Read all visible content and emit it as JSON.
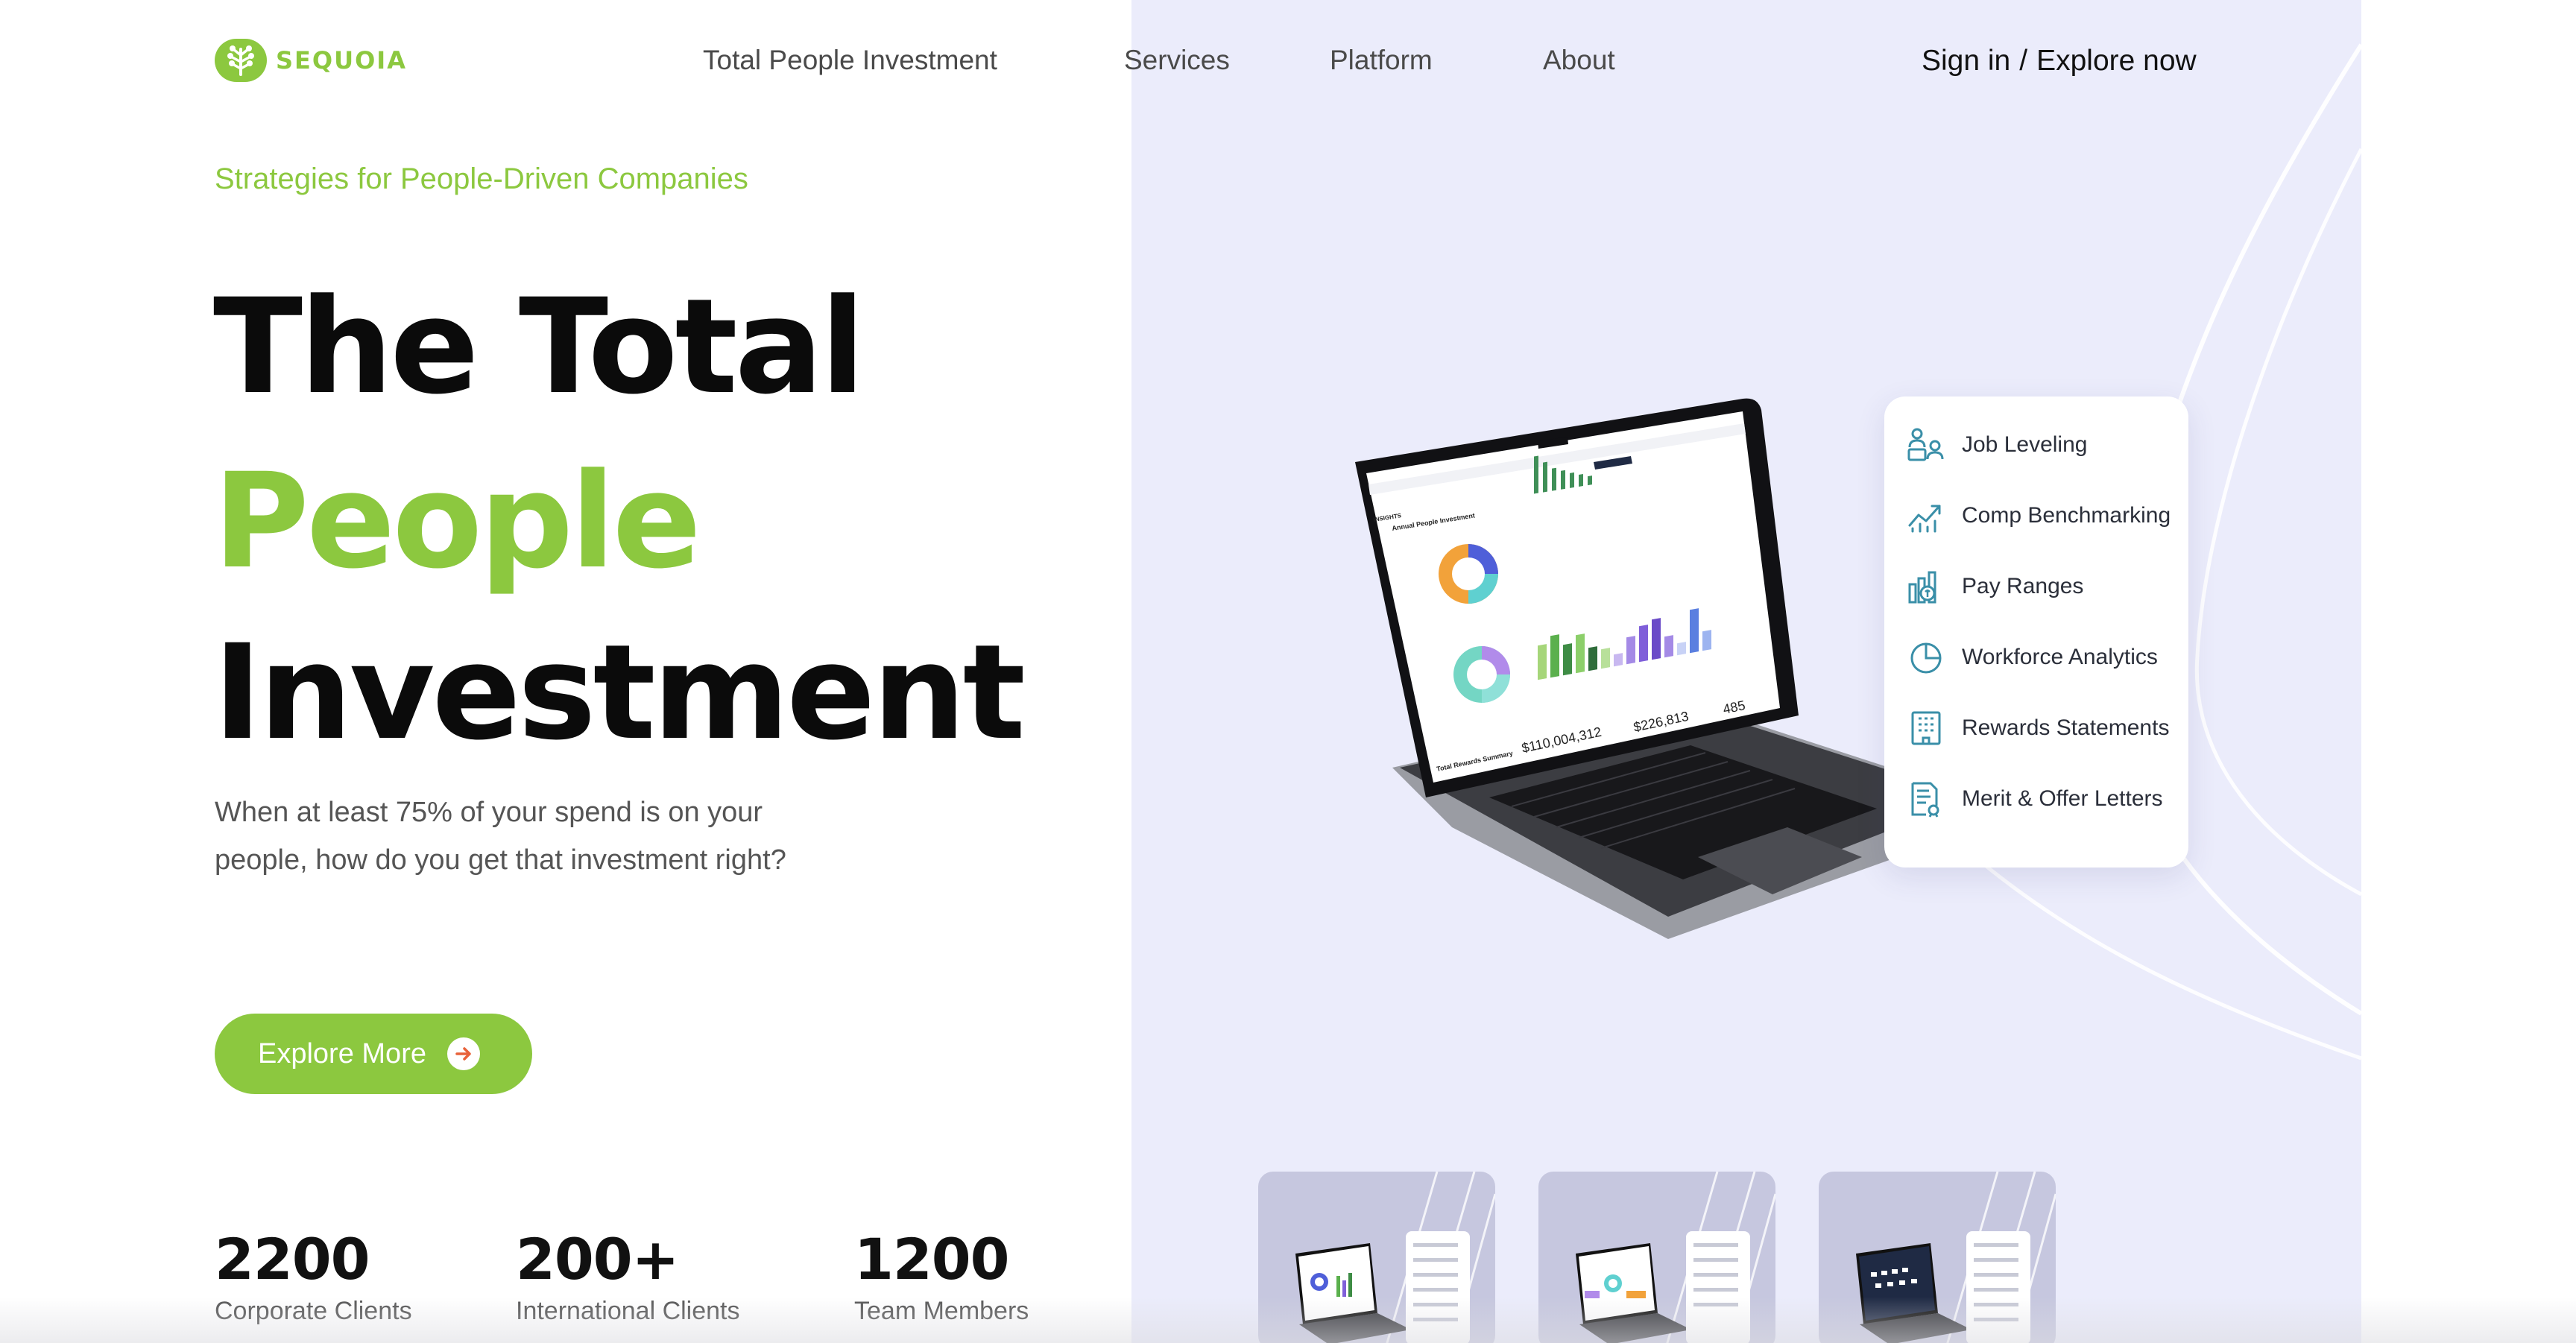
{
  "brand": {
    "name": "SEQUOIA",
    "accent": "#8cc83f",
    "panel_bg": "#ebecfb",
    "logo_icon": "tree-icon"
  },
  "nav": {
    "items": [
      "Total People Investment",
      "Services",
      "Platform",
      "About"
    ]
  },
  "auth": {
    "sign_in": "Sign in",
    "separator": "/",
    "explore": "Explore now"
  },
  "hero": {
    "tagline": "Strategies for People-Driven Companies",
    "title_line1": "The Total",
    "title_line2": "People",
    "title_line3": "Investment",
    "description": "When at least 75% of your spend is on your people, how do you get that investment right?",
    "cta_label": "Explore More",
    "cta_icon": "arrow-right-icon"
  },
  "stats": [
    {
      "value": "2200",
      "label": "Corporate Clients"
    },
    {
      "value": "200+",
      "label": "International Clients"
    },
    {
      "value": "1200",
      "label": "Team Members"
    }
  ],
  "features": [
    {
      "label": "Job Leveling",
      "icon": "job-leveling-icon"
    },
    {
      "label": "Comp Benchmarking",
      "icon": "trend-chart-icon"
    },
    {
      "label": "Pay Ranges",
      "icon": "pay-ranges-icon"
    },
    {
      "label": "Workforce Analytics",
      "icon": "pie-chart-icon"
    },
    {
      "label": "Rewards Statements",
      "icon": "building-icon"
    },
    {
      "label": "Merit & Offer Letters",
      "icon": "document-icon"
    }
  ],
  "laptop": {
    "screen_title": "Annual People Investment",
    "app_label": "INSIGHTS",
    "summary_label": "Total Rewards Summary",
    "amount_1": "$110,004,312",
    "amount_2": "$226,813",
    "count": "485"
  }
}
